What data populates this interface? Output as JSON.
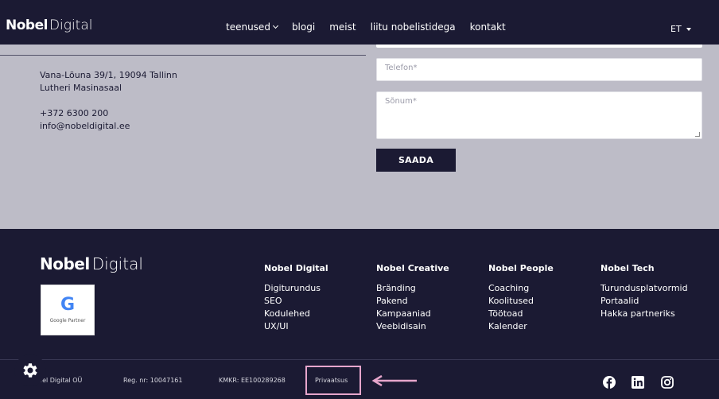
{
  "header": {
    "logo_bold": "Nobel",
    "logo_light": "Digital",
    "nav": [
      "teenused",
      "blogi",
      "meist",
      "liitu nobelistidega",
      "kontakt"
    ],
    "language": "ET"
  },
  "contact": {
    "address_line1": "Vana-Lõuna 39/1, 19094 Tallinn",
    "address_line2": "Lutheri Masinasaal",
    "phone": "+372 6300 200",
    "email": "info@nobeldigital.ee",
    "form": {
      "phone_placeholder": "Telefon*",
      "message_placeholder": "Sõnum*",
      "submit_label": "SAADA"
    }
  },
  "footer": {
    "logo_bold": "Nobel",
    "logo_light": "Digital",
    "badge": {
      "g": "G",
      "text": "Google Partner"
    },
    "columns": [
      {
        "title": "Nobel Digital",
        "items": [
          "Digiturundus",
          "SEO",
          "Kodulehed",
          "UX/UI"
        ]
      },
      {
        "title": "Nobel Creative",
        "items": [
          "Bränding",
          "Pakend",
          "Kampaaniad",
          "Veebidisain"
        ]
      },
      {
        "title": "Nobel People",
        "items": [
          "Coaching",
          "Koolitused",
          "Töötoad",
          "Kalender"
        ]
      },
      {
        "title": "Nobel Tech",
        "items": [
          "Turundusplatvormid",
          "Portaalid",
          "Hakka partneriks"
        ]
      }
    ],
    "legal": {
      "company": "bel Digital OÜ",
      "reg": "Reg. nr: 10047161",
      "kmkr": "KMKR: EE100289268",
      "privacy": "Privaatsus"
    },
    "highlight_color": "#e7a6cc"
  },
  "colors": {
    "navy": "#1b1a33",
    "section_gray": "#bdbcc7"
  }
}
